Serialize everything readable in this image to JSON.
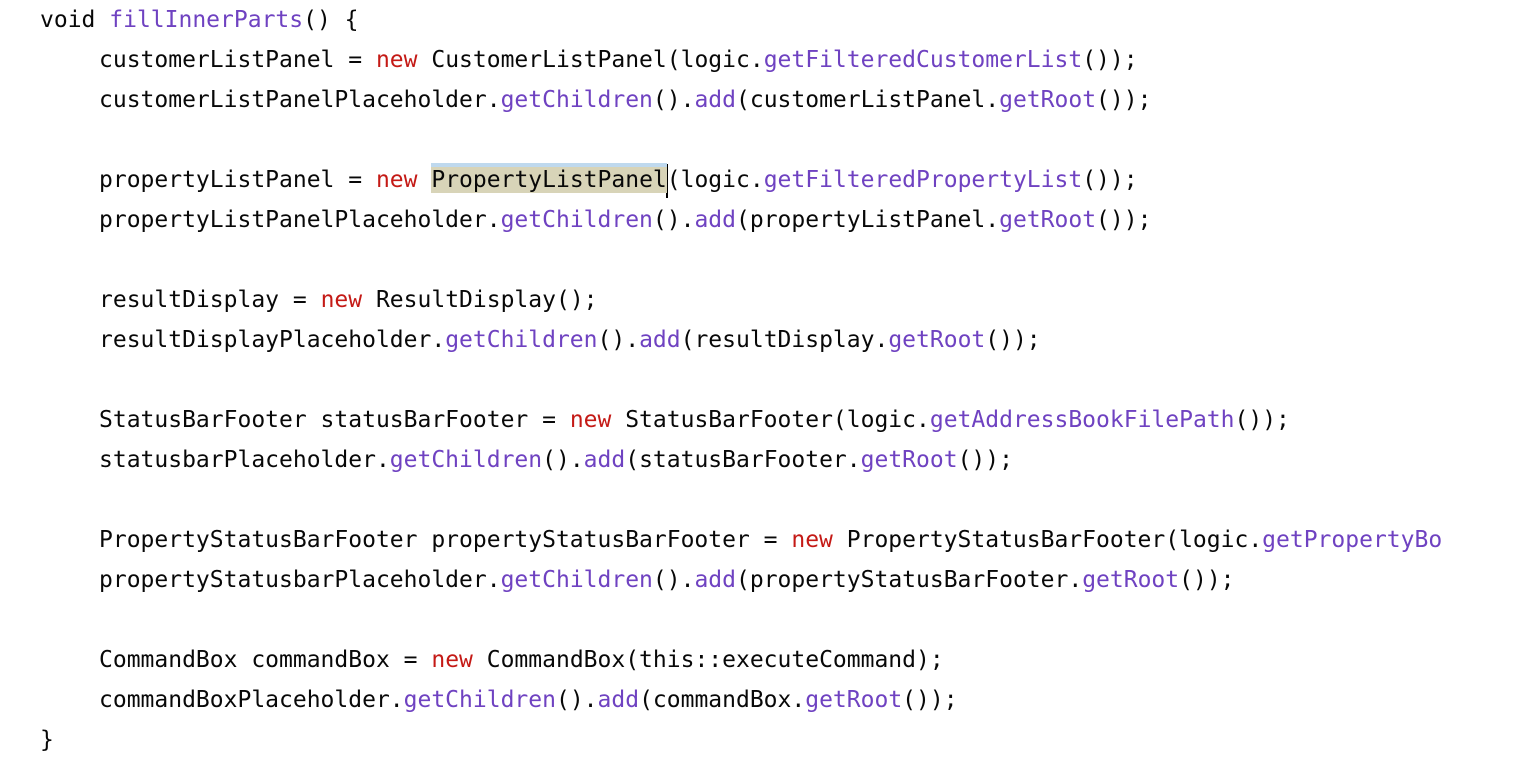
{
  "editor": {
    "lines": [
      {
        "indent": 0,
        "tokens": [
          {
            "t": "void ",
            "k": "plain"
          },
          {
            "t": "fillInnerParts",
            "k": "method"
          },
          {
            "t": "() {",
            "k": "plain"
          }
        ]
      },
      {
        "indent": 1,
        "tokens": [
          {
            "t": "customerListPanel = ",
            "k": "plain"
          },
          {
            "t": "new",
            "k": "new"
          },
          {
            "t": " CustomerListPanel(logic.",
            "k": "plain"
          },
          {
            "t": "getFilteredCustomerList",
            "k": "method"
          },
          {
            "t": "());",
            "k": "plain"
          }
        ]
      },
      {
        "indent": 1,
        "tokens": [
          {
            "t": "customerListPanelPlaceholder.",
            "k": "plain"
          },
          {
            "t": "getChildren",
            "k": "method"
          },
          {
            "t": "().",
            "k": "plain"
          },
          {
            "t": "add",
            "k": "method"
          },
          {
            "t": "(customerListPanel.",
            "k": "plain"
          },
          {
            "t": "getRoot",
            "k": "method"
          },
          {
            "t": "());",
            "k": "plain"
          }
        ]
      },
      {
        "indent": 0,
        "tokens": []
      },
      {
        "indent": 1,
        "tokens": [
          {
            "t": "propertyListPanel = ",
            "k": "plain"
          },
          {
            "t": "new",
            "k": "new"
          },
          {
            "t": " ",
            "k": "plain"
          },
          {
            "t": "PropertyListPanel",
            "k": "highlight"
          },
          {
            "t": "",
            "k": "caret"
          },
          {
            "t": "(logic.",
            "k": "plain"
          },
          {
            "t": "getFilteredPropertyList",
            "k": "method"
          },
          {
            "t": "());",
            "k": "plain"
          }
        ]
      },
      {
        "indent": 1,
        "tokens": [
          {
            "t": "propertyListPanelPlaceholder.",
            "k": "plain"
          },
          {
            "t": "getChildren",
            "k": "method"
          },
          {
            "t": "().",
            "k": "plain"
          },
          {
            "t": "add",
            "k": "method"
          },
          {
            "t": "(propertyListPanel.",
            "k": "plain"
          },
          {
            "t": "getRoot",
            "k": "method"
          },
          {
            "t": "());",
            "k": "plain"
          }
        ]
      },
      {
        "indent": 0,
        "tokens": []
      },
      {
        "indent": 1,
        "tokens": [
          {
            "t": "resultDisplay = ",
            "k": "plain"
          },
          {
            "t": "new",
            "k": "new"
          },
          {
            "t": " ResultDisplay();",
            "k": "plain"
          }
        ]
      },
      {
        "indent": 1,
        "tokens": [
          {
            "t": "resultDisplayPlaceholder.",
            "k": "plain"
          },
          {
            "t": "getChildren",
            "k": "method"
          },
          {
            "t": "().",
            "k": "plain"
          },
          {
            "t": "add",
            "k": "method"
          },
          {
            "t": "(resultDisplay.",
            "k": "plain"
          },
          {
            "t": "getRoot",
            "k": "method"
          },
          {
            "t": "());",
            "k": "plain"
          }
        ]
      },
      {
        "indent": 0,
        "tokens": []
      },
      {
        "indent": 1,
        "tokens": [
          {
            "t": "StatusBarFooter statusBarFooter = ",
            "k": "plain"
          },
          {
            "t": "new",
            "k": "new"
          },
          {
            "t": " StatusBarFooter(logic.",
            "k": "plain"
          },
          {
            "t": "getAddressBookFilePath",
            "k": "method"
          },
          {
            "t": "());",
            "k": "plain"
          }
        ]
      },
      {
        "indent": 1,
        "tokens": [
          {
            "t": "statusbarPlaceholder.",
            "k": "plain"
          },
          {
            "t": "getChildren",
            "k": "method"
          },
          {
            "t": "().",
            "k": "plain"
          },
          {
            "t": "add",
            "k": "method"
          },
          {
            "t": "(statusBarFooter.",
            "k": "plain"
          },
          {
            "t": "getRoot",
            "k": "method"
          },
          {
            "t": "());",
            "k": "plain"
          }
        ]
      },
      {
        "indent": 0,
        "tokens": []
      },
      {
        "indent": 1,
        "tokens": [
          {
            "t": "PropertyStatusBarFooter propertyStatusBarFooter = ",
            "k": "plain"
          },
          {
            "t": "new",
            "k": "new"
          },
          {
            "t": " PropertyStatusBarFooter(logic.",
            "k": "plain"
          },
          {
            "t": "getPropertyBo",
            "k": "method"
          }
        ]
      },
      {
        "indent": 1,
        "tokens": [
          {
            "t": "propertyStatusbarPlaceholder.",
            "k": "plain"
          },
          {
            "t": "getChildren",
            "k": "method"
          },
          {
            "t": "().",
            "k": "plain"
          },
          {
            "t": "add",
            "k": "method"
          },
          {
            "t": "(propertyStatusBarFooter.",
            "k": "plain"
          },
          {
            "t": "getRoot",
            "k": "method"
          },
          {
            "t": "());",
            "k": "plain"
          }
        ]
      },
      {
        "indent": 0,
        "tokens": []
      },
      {
        "indent": 1,
        "tokens": [
          {
            "t": "CommandBox commandBox = ",
            "k": "plain"
          },
          {
            "t": "new",
            "k": "new"
          },
          {
            "t": " CommandBox(this::executeCommand);",
            "k": "plain"
          }
        ]
      },
      {
        "indent": 1,
        "tokens": [
          {
            "t": "commandBoxPlaceholder.",
            "k": "plain"
          },
          {
            "t": "getChildren",
            "k": "method"
          },
          {
            "t": "().",
            "k": "plain"
          },
          {
            "t": "add",
            "k": "method"
          },
          {
            "t": "(commandBox.",
            "k": "plain"
          },
          {
            "t": "getRoot",
            "k": "method"
          },
          {
            "t": "());",
            "k": "plain"
          }
        ]
      },
      {
        "indent": 0,
        "tokens": [
          {
            "t": "}",
            "k": "plain"
          }
        ]
      }
    ]
  },
  "colors": {
    "plain": "#080808",
    "keyword_new": "#c41a16",
    "method": "#6f42c1",
    "highlight_bg": "#d8d4b8",
    "highlight_top": "#bfd9ee",
    "caret": "#000000"
  }
}
